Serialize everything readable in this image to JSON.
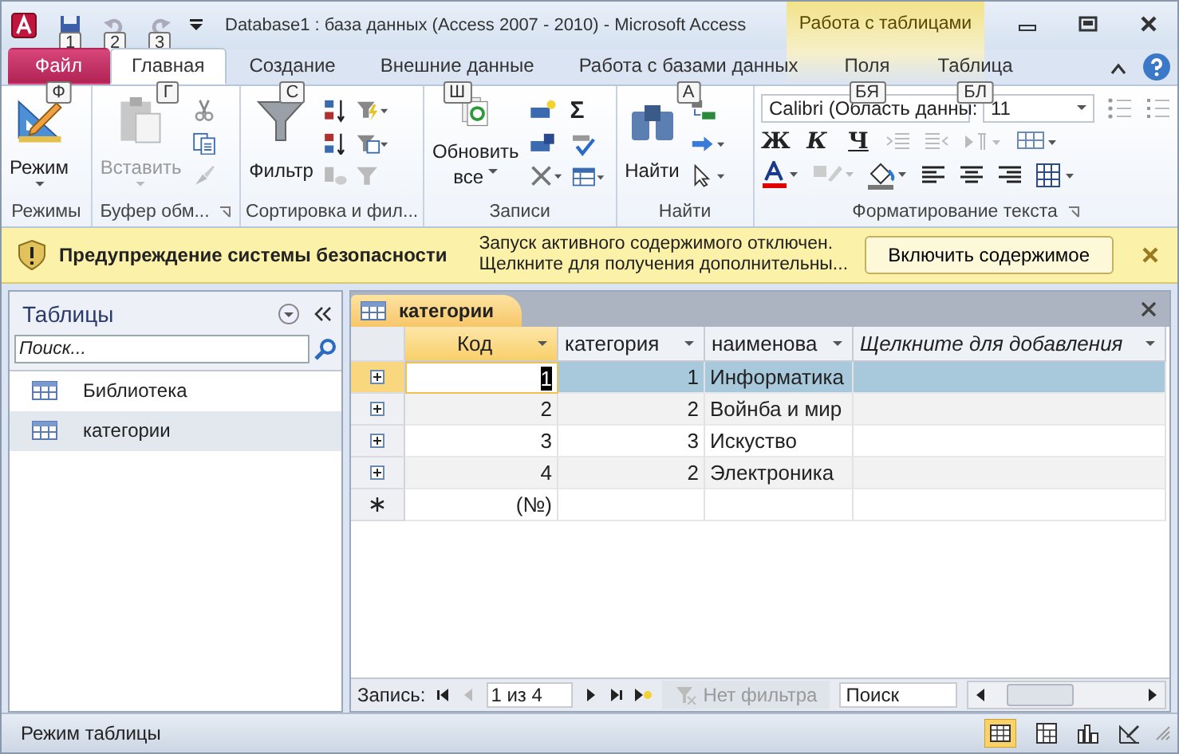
{
  "title_bar": {
    "quick_access_keytips": [
      "1",
      "2",
      "3"
    ],
    "title": "Database1 : база данных (Access 2007 - 2010)  -  Microsoft Access",
    "context_group": "Работа с таблицами"
  },
  "ribbon_tabs": [
    {
      "label": "Файл",
      "keytip": "Ф",
      "kind": "file",
      "selected": false
    },
    {
      "label": "Главная",
      "keytip": "Г",
      "kind": "normal",
      "selected": true
    },
    {
      "label": "Создание",
      "keytip": "С",
      "kind": "normal",
      "selected": false
    },
    {
      "label": "Внешние данные",
      "keytip": "Ш",
      "kind": "normal",
      "selected": false
    },
    {
      "label": "Работа с базами данных",
      "keytip": "А",
      "kind": "normal",
      "selected": false
    },
    {
      "label": "Поля",
      "keytip": "БЯ",
      "kind": "contextual",
      "selected": false
    },
    {
      "label": "Таблица",
      "keytip": "БЛ",
      "kind": "contextual",
      "selected": false
    }
  ],
  "ribbon": {
    "view_button": "Режим",
    "paste_button": {
      "label": "Вставить",
      "disabled": true
    },
    "filter_button": "Фильтр",
    "refresh_button": {
      "line1": "Обновить",
      "line2": "все"
    },
    "totals_glyph": "Σ",
    "find_button": "Найти",
    "font_name": "Calibri (Область данны:",
    "font_size": "11",
    "bold": "Ж",
    "italic": "К",
    "underline": "Ч",
    "group_labels": [
      "Режимы",
      "Буфер обм...",
      "Сортировка и фил...",
      "Записи",
      "Найти",
      "Форматирование текста"
    ]
  },
  "security_bar": {
    "title": "Предупреждение системы безопасности",
    "message_lines": [
      "Запуск активного содержимого отключен.",
      "Щелкните для получения дополнительны..."
    ],
    "button": "Включить содержимое"
  },
  "navigation_pane": {
    "title": "Таблицы",
    "search_placeholder": "Поиск...",
    "items": [
      {
        "label": "Библиотека",
        "selected": false
      },
      {
        "label": "категории",
        "selected": true
      }
    ]
  },
  "document_tab": "категории",
  "table": {
    "columns": [
      {
        "label": "Код",
        "selected": true,
        "italic": false
      },
      {
        "label": "категория",
        "selected": false,
        "italic": false
      },
      {
        "label": "наименова",
        "selected": false,
        "italic": false
      },
      {
        "label": "Щелкните для добавления",
        "selected": false,
        "italic": true
      }
    ],
    "rows": [
      {
        "cells": [
          "1",
          "1",
          "Информатика"
        ],
        "selected": true
      },
      {
        "cells": [
          "2",
          "2",
          "Войнба и мир"
        ],
        "selected": false
      },
      {
        "cells": [
          "3",
          "3",
          "Искуство"
        ],
        "selected": false
      },
      {
        "cells": [
          "4",
          "2",
          "Электроника"
        ],
        "selected": false
      }
    ],
    "new_row": "(№)"
  },
  "record_navigator": {
    "label": "Запись:",
    "position": "1 из 4",
    "filter": "Нет фильтра",
    "search": "Поиск"
  },
  "status_bar": {
    "text": "Режим таблицы"
  }
}
